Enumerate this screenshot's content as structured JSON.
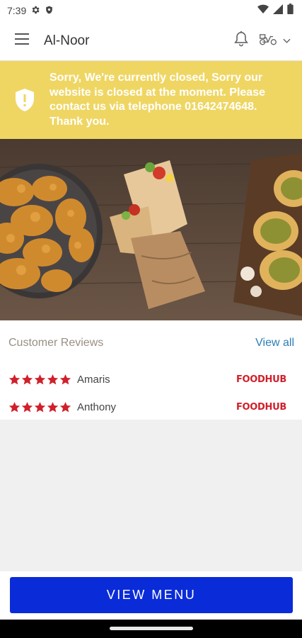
{
  "status_bar": {
    "time": "7:39",
    "icons": [
      "settings-icon",
      "shield-icon",
      "wifi-icon",
      "signal-icon",
      "battery-icon"
    ]
  },
  "app_bar": {
    "title": "Al-Noor",
    "icons": [
      "menu-icon",
      "bell-icon",
      "scooter-icon",
      "chevron-down-icon"
    ]
  },
  "closed_banner": {
    "message": "Sorry, We're currently closed, Sorry our website is closed at the moment. Please contact us via telephone 01642474648. Thank you.",
    "icon": "shield-alert-icon",
    "background": "#efd663"
  },
  "hero": {
    "description_icon": "food-photo"
  },
  "reviews": {
    "title": "Customer Reviews",
    "view_all": "View all",
    "items": [
      {
        "name": "Amaris",
        "rating": 5,
        "source": "FOODHUB"
      },
      {
        "name": "Anthony",
        "rating": 5,
        "source": "FOODHUB"
      }
    ],
    "star_color": "#d0202a"
  },
  "cta": {
    "label": "VIEW MENU",
    "color": "#0a2bd8"
  }
}
